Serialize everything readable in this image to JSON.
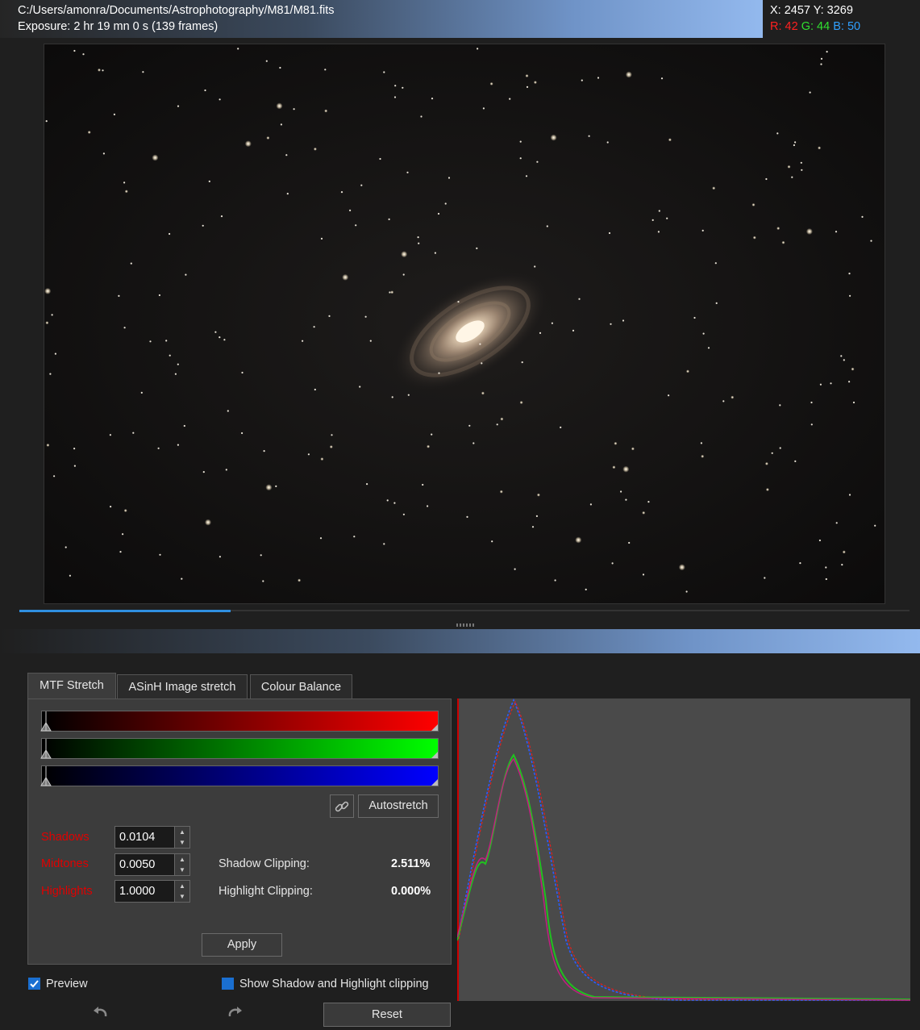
{
  "header": {
    "file_path": "C:/Users/amonra/Documents/Astrophotography/M81/M81.fits",
    "exposure": "Exposure: 2 hr 19 mn 0 s (139 frames)"
  },
  "pixel_info": {
    "xy": "X: 2457 Y: 3269",
    "r_label": "R:",
    "r_value": "42",
    "g_label": "G:",
    "g_value": "44",
    "b_label": "B:",
    "b_value": "50",
    "r_color": "#ff2020",
    "g_color": "#30e030",
    "b_color": "#30a0ff"
  },
  "load_progress": 0.237,
  "tabs": [
    {
      "label": "MTF Stretch",
      "active": true
    },
    {
      "label": "ASinH Image stretch",
      "active": false
    },
    {
      "label": "Colour Balance",
      "active": false
    }
  ],
  "mtf": {
    "link_icon": "link-icon",
    "autostretch_label": "Autostretch",
    "shadows_label": "Shadows",
    "shadows_value": "0.0104",
    "midtones_label": "Midtones",
    "midtones_value": "0.0050",
    "highlights_label": "Highlights",
    "highlights_value": "1.0000",
    "shadow_clipping_label": "Shadow Clipping:",
    "shadow_clipping_value": "2.511%",
    "highlight_clipping_label": "Highlight Clipping:",
    "highlight_clipping_value": "0.000%",
    "apply_label": "Apply"
  },
  "footer": {
    "preview_label": "Preview",
    "preview_checked": true,
    "clipping_label": "Show Shadow and Highlight clipping",
    "clipping_checked": false,
    "undo_icon": "undo-icon",
    "redo_icon": "redo-icon",
    "reset_label": "Reset"
  }
}
